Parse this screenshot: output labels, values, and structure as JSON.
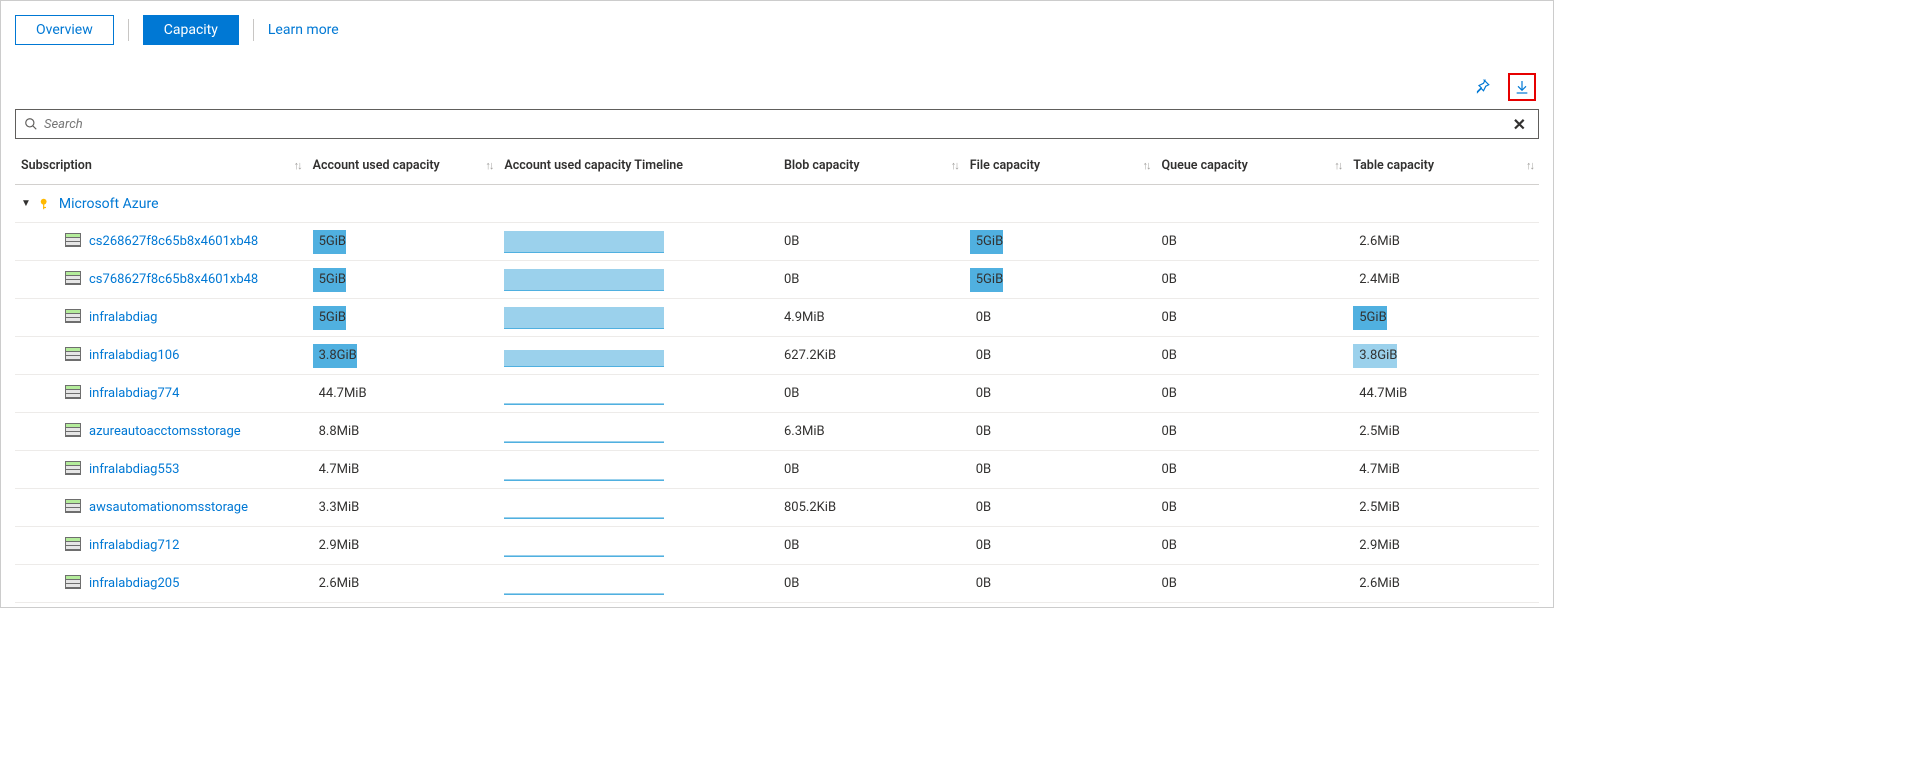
{
  "tabs": {
    "overview": "Overview",
    "capacity": "Capacity",
    "learn_more": "Learn more"
  },
  "search": {
    "placeholder": "Search"
  },
  "columns": {
    "subscription": "Subscription",
    "account_used": "Account used capacity",
    "timeline": "Account used capacity Timeline",
    "blob": "Blob capacity",
    "file": "File capacity",
    "queue": "Queue capacity",
    "table": "Table capacity"
  },
  "group": {
    "name": "Microsoft Azure"
  },
  "rows": [
    {
      "name": "cs268627f8c65b8x4601xb48",
      "used": "5GiB",
      "used_pct": 100,
      "tl_pct": 100,
      "blob": "0B",
      "file": "5GiB",
      "file_pct": 100,
      "queue": "0B",
      "table": "2.6MiB",
      "table_pct": 0
    },
    {
      "name": "cs768627f8c65b8x4601xb48",
      "used": "5GiB",
      "used_pct": 100,
      "tl_pct": 100,
      "blob": "0B",
      "file": "5GiB",
      "file_pct": 100,
      "queue": "0B",
      "table": "2.4MiB",
      "table_pct": 0
    },
    {
      "name": "infralabdiag",
      "used": "5GiB",
      "used_pct": 100,
      "tl_pct": 100,
      "blob": "4.9MiB",
      "file": "0B",
      "file_pct": 0,
      "queue": "0B",
      "table": "5GiB",
      "table_pct": 100
    },
    {
      "name": "infralabdiag106",
      "used": "3.8GiB",
      "used_pct": 100,
      "tl_pct": 76,
      "blob": "627.2KiB",
      "file": "0B",
      "file_pct": 0,
      "queue": "0B",
      "table": "3.8GiB",
      "table_pct": 100,
      "table_light": true
    },
    {
      "name": "infralabdiag774",
      "used": "44.7MiB",
      "used_pct": 0,
      "tl_pct": 2,
      "blob": "0B",
      "file": "0B",
      "file_pct": 0,
      "queue": "0B",
      "table": "44.7MiB",
      "table_pct": 0
    },
    {
      "name": "azureautoacctomsstorage",
      "used": "8.8MiB",
      "used_pct": 0,
      "tl_pct": 1,
      "blob": "6.3MiB",
      "file": "0B",
      "file_pct": 0,
      "queue": "0B",
      "table": "2.5MiB",
      "table_pct": 0
    },
    {
      "name": "infralabdiag553",
      "used": "4.7MiB",
      "used_pct": 0,
      "tl_pct": 1,
      "blob": "0B",
      "file": "0B",
      "file_pct": 0,
      "queue": "0B",
      "table": "4.7MiB",
      "table_pct": 0
    },
    {
      "name": "awsautomationomsstorage",
      "used": "3.3MiB",
      "used_pct": 0,
      "tl_pct": 1,
      "blob": "805.2KiB",
      "file": "0B",
      "file_pct": 0,
      "queue": "0B",
      "table": "2.5MiB",
      "table_pct": 0
    },
    {
      "name": "infralabdiag712",
      "used": "2.9MiB",
      "used_pct": 0,
      "tl_pct": 1,
      "blob": "0B",
      "file": "0B",
      "file_pct": 0,
      "queue": "0B",
      "table": "2.9MiB",
      "table_pct": 0
    },
    {
      "name": "infralabdiag205",
      "used": "2.6MiB",
      "used_pct": 0,
      "tl_pct": 1,
      "blob": "0B",
      "file": "0B",
      "file_pct": 0,
      "queue": "0B",
      "table": "2.6MiB",
      "table_pct": 0
    }
  ]
}
